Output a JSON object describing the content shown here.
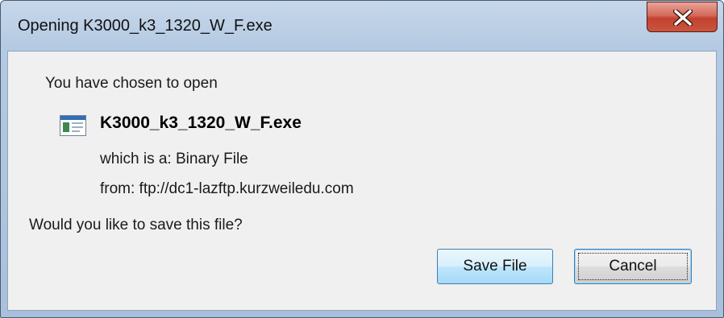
{
  "window": {
    "title": "Opening K3000_k3_1320_W_F.exe",
    "close_icon": "close-x-icon"
  },
  "dialog": {
    "heading": "You have chosen to open",
    "file_icon": "executable-file-icon",
    "file_name": "K3000_k3_1320_W_F.exe",
    "which_is": "which is a:  Binary File",
    "from": "from:  ftp://dc1-lazftp.kurzweiledu.com",
    "question": "Would you like to save this file?"
  },
  "buttons": {
    "save_label": "Save File",
    "cancel_label": "Cancel"
  },
  "colors": {
    "frame": "#b4c9e2",
    "client": "#f0f0f0",
    "close_button": "#c9553e",
    "default_button_border": "#3c7fb1"
  }
}
